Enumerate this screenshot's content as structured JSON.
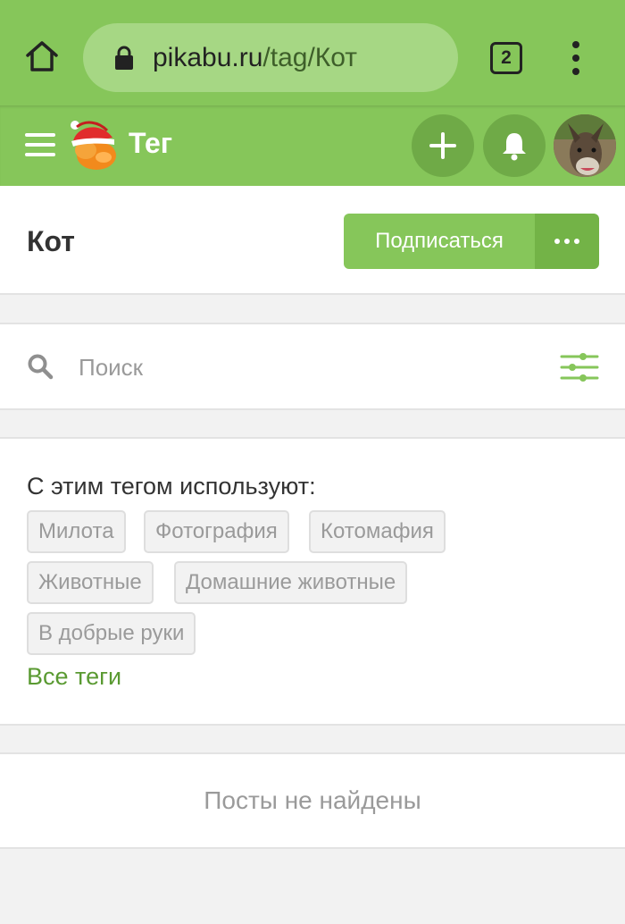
{
  "browser": {
    "url_host": "pikabu.ru",
    "url_path": "/tag/Кот",
    "tab_count": "2"
  },
  "header": {
    "title": "Тег"
  },
  "tag": {
    "name": "Кот",
    "subscribe_label": "Подписаться"
  },
  "search": {
    "placeholder": "Поиск"
  },
  "related": {
    "title": "С этим тегом используют:",
    "tags": [
      "Милота",
      "Фотография",
      "Котомафия",
      "Животные",
      "Домашние животные",
      "В добрые руки"
    ],
    "all_tags_label": "Все теги"
  },
  "empty": {
    "message": "Посты не найдены"
  },
  "colors": {
    "brand_green": "#86c65a",
    "dark_green": "#6faa47",
    "link_green": "#5a9a32"
  },
  "icons": [
    "home-icon",
    "lock-icon",
    "tabs-icon",
    "more-vert-icon",
    "hamburger-icon",
    "logo-icon",
    "plus-icon",
    "bell-icon",
    "search-icon",
    "filter-icon",
    "more-horiz-icon"
  ]
}
